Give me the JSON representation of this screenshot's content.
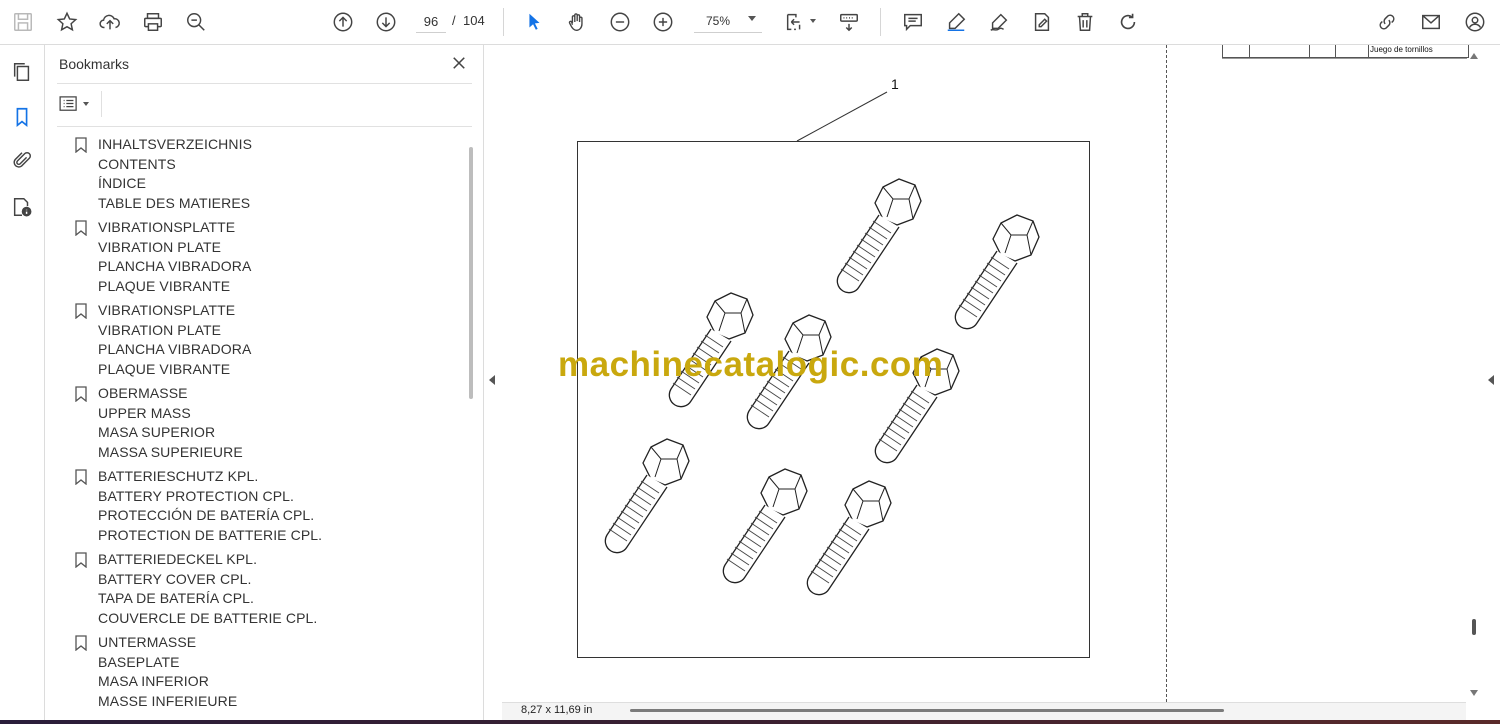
{
  "toolbar": {
    "page_current": "96",
    "page_separator": "/",
    "page_total": "104",
    "zoom": "75%",
    "icons": [
      "save-icon",
      "star-icon",
      "upload-icon",
      "print-icon",
      "zoom-search-icon",
      "page-up-icon",
      "page-down-icon",
      "pointer-icon",
      "hand-icon",
      "zoom-out-icon",
      "zoom-in-icon",
      "fit-page-icon",
      "scroll-mode-icon",
      "comment-icon",
      "highlight-icon",
      "draw-icon",
      "sign-icon",
      "delete-icon",
      "redo-icon",
      "share-link-icon",
      "email-icon",
      "account-icon"
    ]
  },
  "sidebar": {
    "title": "Bookmarks",
    "bookmarks": [
      {
        "lines": [
          "INHALTSVERZEICHNIS",
          "CONTENTS",
          "ÍNDICE",
          "TABLE DES MATIERES"
        ]
      },
      {
        "lines": [
          "VIBRATIONSPLATTE",
          "VIBRATION PLATE",
          "PLANCHA VIBRADORA",
          "PLAQUE VIBRANTE"
        ]
      },
      {
        "lines": [
          "VIBRATIONSPLATTE",
          "VIBRATION PLATE",
          "PLANCHA VIBRADORA",
          "PLAQUE VIBRANTE"
        ]
      },
      {
        "lines": [
          "OBERMASSE",
          "UPPER MASS",
          "MASA SUPERIOR",
          "MASSA SUPERIEURE"
        ]
      },
      {
        "lines": [
          "BATTERIESCHUTZ KPL.",
          "BATTERY PROTECTION CPL.",
          "PROTECCIÓN DE BATERÍA CPL.",
          "PROTECTION DE BATTERIE CPL."
        ]
      },
      {
        "lines": [
          "BATTERIEDECKEL KPL.",
          "BATTERY COVER CPL.",
          "TAPA DE BATERÍA CPL.",
          "COUVERCLE DE BATTERIE CPL."
        ]
      },
      {
        "lines": [
          "UNTERMASSE",
          "BASEPLATE",
          "MASA INFERIOR",
          "MASSE INFERIEURE"
        ]
      }
    ]
  },
  "document": {
    "table_fragment_text": "Juego de tornillos",
    "callout_number": "1",
    "watermark": "machinecatalogic.com",
    "page_size": "8,27 x 11,69 in"
  },
  "colors": {
    "watermark": "#c9a80e",
    "pointer_accent": "#1473e6"
  }
}
